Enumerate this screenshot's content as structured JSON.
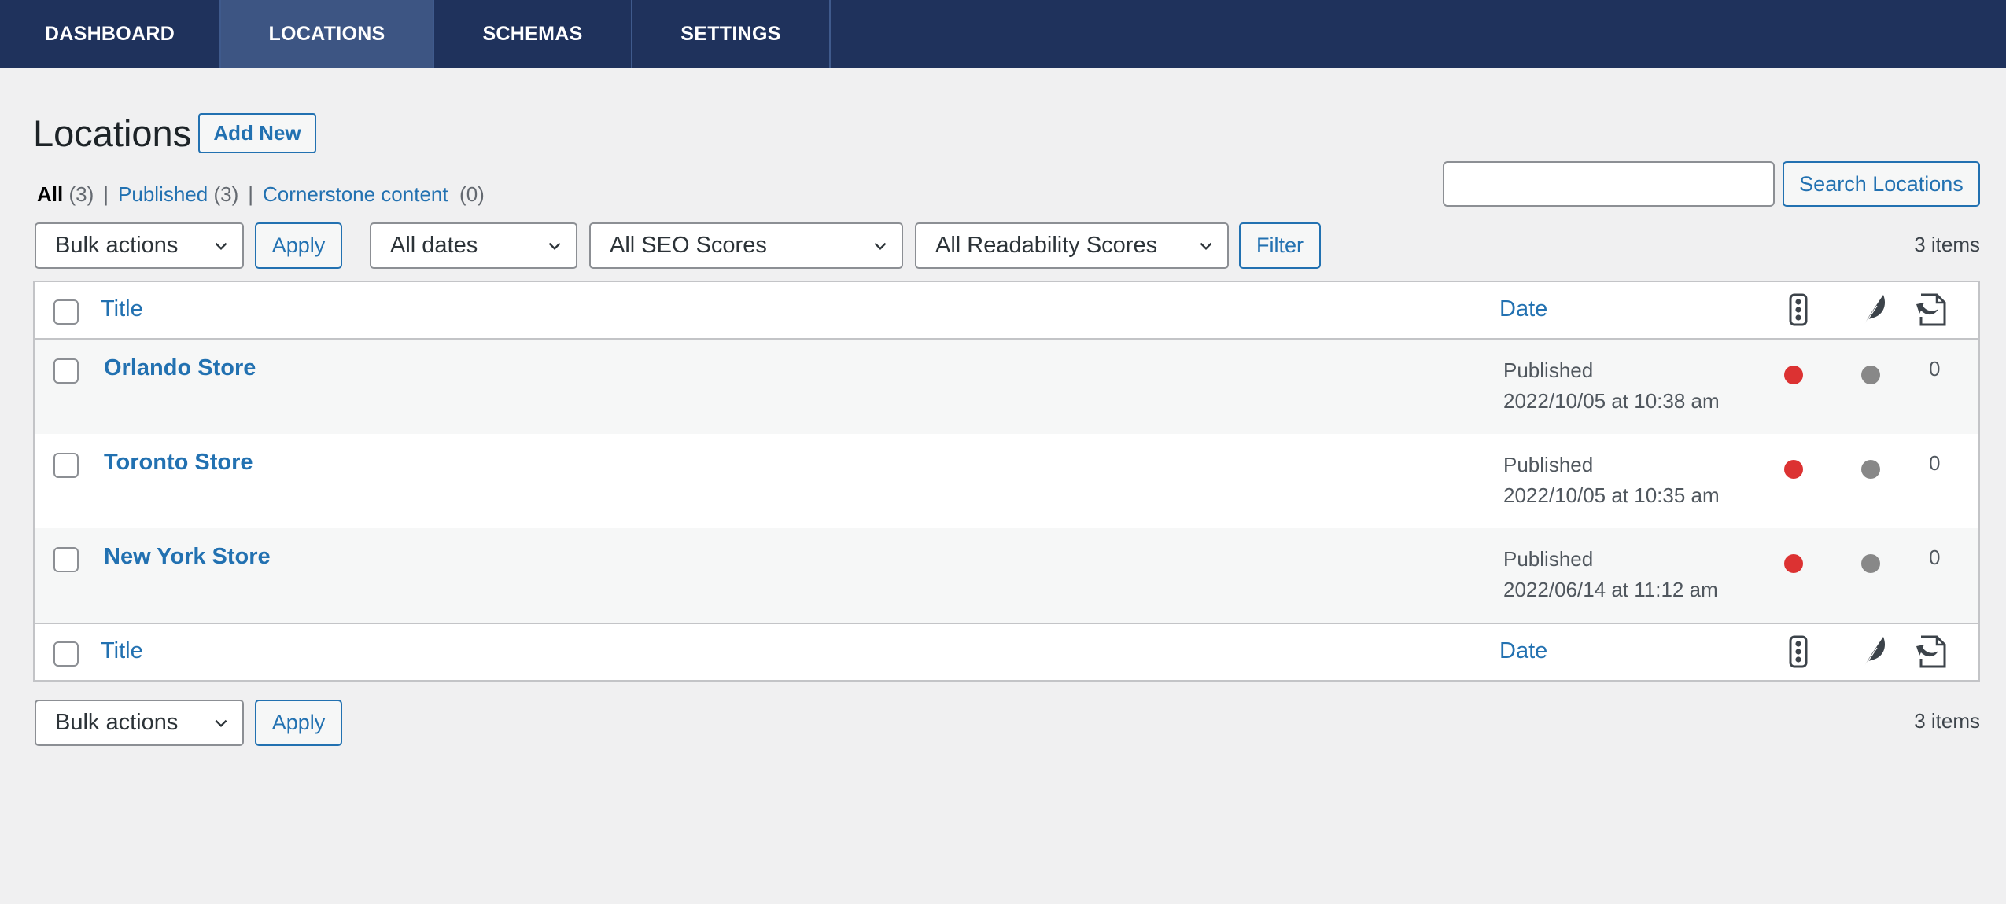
{
  "nav": {
    "tabs": [
      {
        "label": "DASHBOARD",
        "active": false
      },
      {
        "label": "LOCATIONS",
        "active": true
      },
      {
        "label": "SCHEMAS",
        "active": false
      },
      {
        "label": "SETTINGS",
        "active": false
      }
    ]
  },
  "header": {
    "title": "Locations",
    "add_new_label": "Add New"
  },
  "views": {
    "all": {
      "label": "All",
      "count": "(3)"
    },
    "published": {
      "label": "Published",
      "count": "(3)"
    },
    "cornerstone": {
      "label": "Cornerstone content",
      "count": "(0)"
    },
    "separator": "|"
  },
  "search": {
    "value": "",
    "placeholder": "",
    "button_label": "Search Locations"
  },
  "filters": {
    "bulk_actions": "Bulk actions",
    "apply_label": "Apply",
    "dates": "All dates",
    "seo_scores": "All SEO Scores",
    "readability_scores": "All Readability Scores",
    "filter_label": "Filter"
  },
  "items_count": "3 items",
  "table": {
    "columns": {
      "title": "Title",
      "date": "Date",
      "seo_icon": "seo-score-icon",
      "readability_icon": "readability-score-icon",
      "links_icon": "internal-links-icon"
    },
    "rows": [
      {
        "title": "Orlando Store",
        "status": "Published",
        "date": "2022/10/05 at 10:38 am",
        "seo": "bad",
        "readability": "none",
        "links": "0"
      },
      {
        "title": "Toronto Store",
        "status": "Published",
        "date": "2022/10/05 at 10:35 am",
        "seo": "bad",
        "readability": "none",
        "links": "0"
      },
      {
        "title": "New York Store",
        "status": "Published",
        "date": "2022/06/14 at 11:12 am",
        "seo": "bad",
        "readability": "none",
        "links": "0"
      }
    ]
  },
  "colors": {
    "nav_bg": "#1f325c",
    "nav_active": "#3d5583",
    "link": "#2271b1",
    "seo_bad": "#dc3232",
    "readability_none": "#888888"
  }
}
